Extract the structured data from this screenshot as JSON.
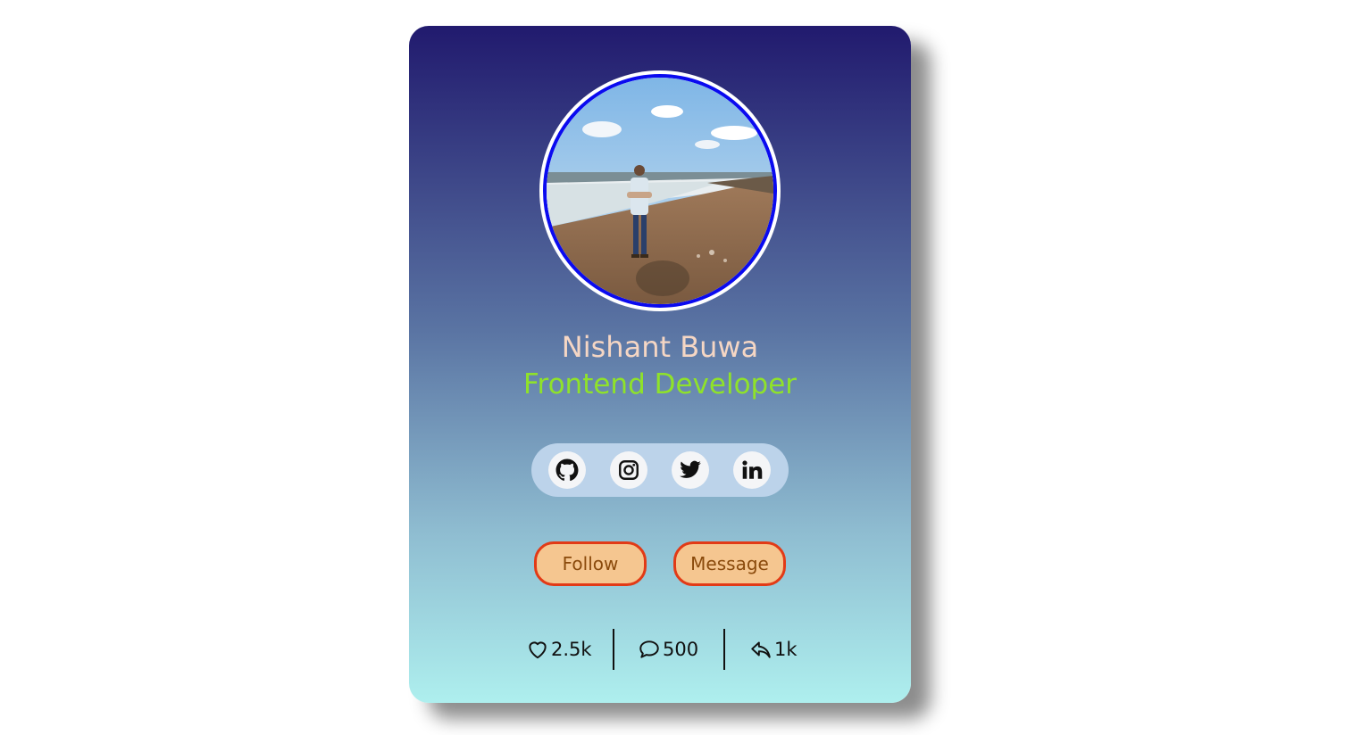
{
  "profile": {
    "name": "Nishant Buwa",
    "role": "Frontend Developer",
    "avatar_alt": "Profile photo on a beach"
  },
  "social": [
    {
      "icon": "github-icon"
    },
    {
      "icon": "instagram-icon"
    },
    {
      "icon": "twitter-icon"
    },
    {
      "icon": "linkedin-icon"
    }
  ],
  "actions": {
    "follow_label": "Follow",
    "message_label": "Message"
  },
  "stats": {
    "likes": "2.5k",
    "comments": "500",
    "shares": "1k"
  },
  "colors": {
    "name": "#f5d6c4",
    "role": "#8fe22a",
    "button_bg": "#f5c690",
    "button_border": "#e23a16",
    "avatar_border": "#0a0af0"
  }
}
